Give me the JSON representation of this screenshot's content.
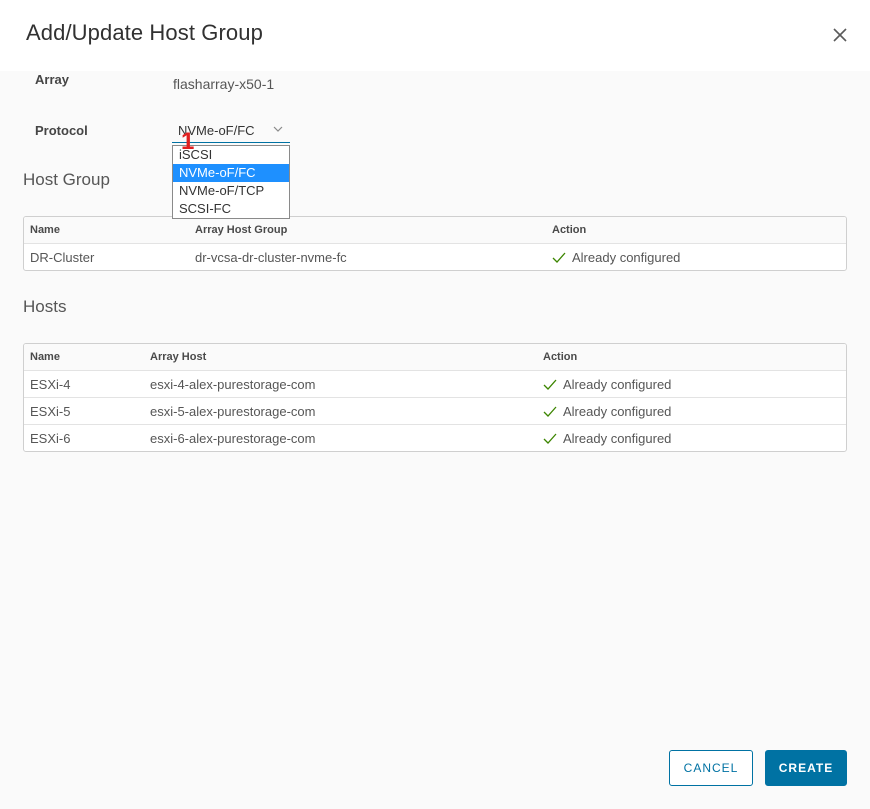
{
  "dialog": {
    "title": "Add/Update Host Group"
  },
  "form": {
    "array_label": "Array",
    "array_value": "flasharray-x50-1",
    "protocol_label": "Protocol",
    "protocol_selected": "NVMe-oF/FC",
    "protocol_options": [
      "iSCSI",
      "NVMe-oF/FC",
      "NVMe-oF/TCP",
      "SCSI-FC"
    ]
  },
  "annotation": {
    "step": "1",
    "color": "#e02020"
  },
  "host_group": {
    "title": "Host Group",
    "columns": [
      "Name",
      "Array Host Group",
      "Action"
    ],
    "rows": [
      {
        "name": "DR-Cluster",
        "array": "dr-vcsa-dr-cluster-nvme-fc",
        "action": "Already configured"
      }
    ]
  },
  "hosts": {
    "title": "Hosts",
    "columns": [
      "Name",
      "Array Host",
      "Action"
    ],
    "rows": [
      {
        "name": "ESXi-4",
        "array": "esxi-4-alex-purestorage-com",
        "action": "Already configured"
      },
      {
        "name": "ESXi-5",
        "array": "esxi-5-alex-purestorage-com",
        "action": "Already configured"
      },
      {
        "name": "ESXi-6",
        "array": "esxi-6-alex-purestorage-com",
        "action": "Already configured"
      }
    ]
  },
  "footer": {
    "cancel_label": "CANCEL",
    "create_label": "CREATE"
  },
  "colors": {
    "primary": "#0072a3",
    "selected_option": "#1e90ff",
    "check": "#3c8500"
  },
  "icons": {
    "close": "close-icon",
    "dropdown": "chevron-down-icon",
    "status": "check-icon"
  }
}
